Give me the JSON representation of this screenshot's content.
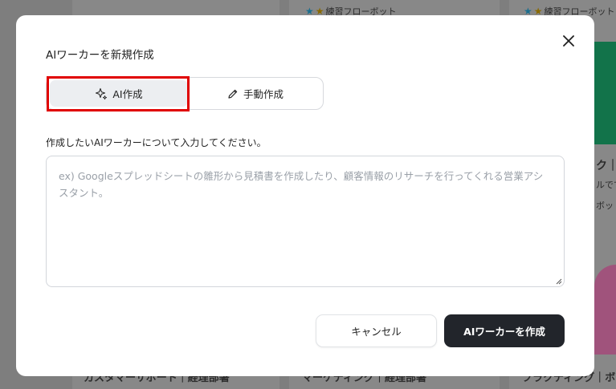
{
  "background": {
    "practice_label": "練習フローボット",
    "partial_label_1": "ク｜",
    "partial_label_2": "ルでで",
    "partial_label_3": "ボット",
    "bottom_left": "カスタマーサポート｜経理部署",
    "bottom_mid": "マーケティング｜経理部署",
    "bottom_right": "プラクティング｜ボ"
  },
  "modal": {
    "title": "AIワーカーを新規作成",
    "tabs": {
      "ai_label": "AI作成",
      "manual_label": "手動作成"
    },
    "instruction": "作成したいAIワーカーについて入力してください。",
    "textarea": {
      "value": "",
      "placeholder": "ex) Googleスプレッドシートの雛形から見積書を作成したり、顧客情報のリサーチを行ってくれる営業アシスタント。"
    },
    "cancel_label": "キャンセル",
    "create_label": "AIワーカーを作成"
  },
  "colors": {
    "highlight": "#e00000",
    "primary_button": "#22252b",
    "selected_tab": "#eceef1"
  }
}
